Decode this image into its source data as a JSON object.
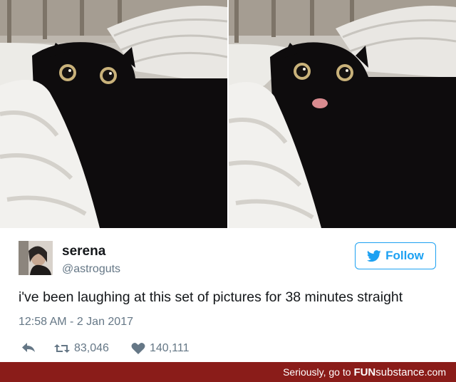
{
  "tweet": {
    "display_name": "serena",
    "handle": "@astroguts",
    "follow_label": "Follow",
    "text": "i've been laughing at this set of pictures for 38 minutes straight",
    "timestamp": "12:58 AM - 2 Jan 2017",
    "retweets": "83,046",
    "likes": "140,111"
  },
  "footer": {
    "prefix": "Seriously, go to ",
    "brand_bold": "FUN",
    "brand_light": "substance",
    "brand_suffix": ".com"
  },
  "colors": {
    "twitter_blue": "#1da1f2",
    "secondary_text": "#657786",
    "footer_red": "#8a1c19"
  },
  "icons": [
    "twitter-bird-icon",
    "reply-icon",
    "retweet-icon",
    "heart-icon"
  ]
}
